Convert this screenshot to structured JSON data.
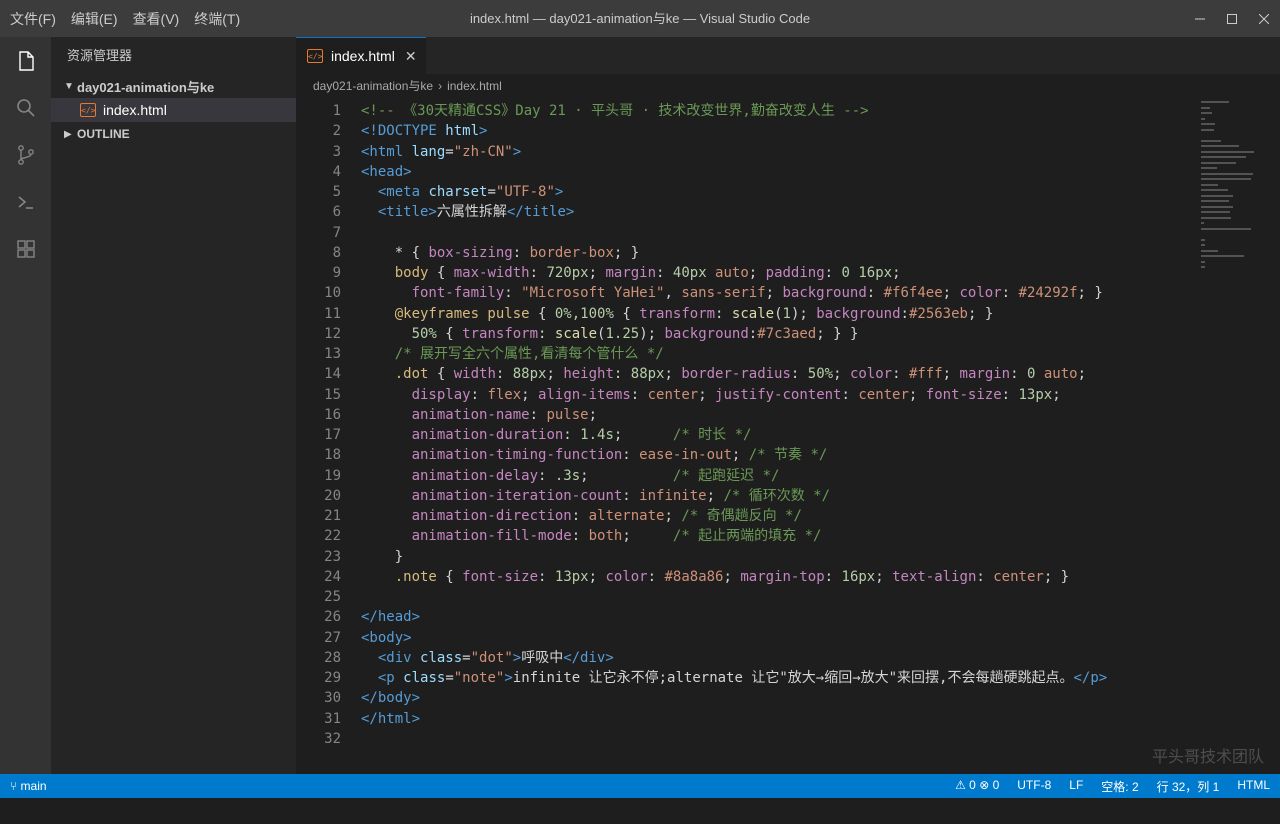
{
  "menu": [
    "文件(F)",
    "编辑(E)",
    "查看(V)",
    "终端(T)"
  ],
  "window_title": "index.html — day021-animation与ke — Visual Studio Code",
  "sidebar": {
    "title": "资源管理器",
    "folder": "day021-animation与ke",
    "file": "index.html",
    "outline": "OUTLINE"
  },
  "tab": {
    "label": "index.html",
    "close": "✕"
  },
  "breadcrumb": {
    "folder": "day021-animation与ke",
    "sep": "›",
    "file": "index.html"
  },
  "code_lines": [
    [
      [
        "com",
        "<!-- 《30天精通CSS》Day 21 · 平头哥 · 技术改变世界,勤奋改变人生 -->"
      ]
    ],
    [
      [
        "tag",
        "<!DOCTYPE "
      ],
      [
        "attr",
        "html"
      ],
      [
        "tag",
        ">"
      ]
    ],
    [
      [
        "tag",
        "<html "
      ],
      [
        "attr",
        "lang"
      ],
      [
        "punc",
        "="
      ],
      [
        "str",
        "\"zh-CN\""
      ],
      [
        "tag",
        ">"
      ]
    ],
    [
      [
        "tag",
        "<head>"
      ]
    ],
    [
      [
        "text",
        "  "
      ],
      [
        "tag",
        "<meta "
      ],
      [
        "attr",
        "charset"
      ],
      [
        "punc",
        "="
      ],
      [
        "str",
        "\"UTF-8\""
      ],
      [
        "tag",
        ">"
      ]
    ],
    [
      [
        "text",
        "  "
      ],
      [
        "tag",
        "<title>"
      ],
      [
        "text",
        "六属性拆解"
      ],
      [
        "tag",
        "</title>"
      ]
    ],
    [
      [
        "text",
        ""
      ]
    ],
    [
      [
        "text",
        "    * "
      ],
      [
        "punc",
        "{ "
      ],
      [
        "prop",
        "box-sizing"
      ],
      [
        "punc",
        ": "
      ],
      [
        "str",
        "border-box"
      ],
      [
        "punc",
        "; }"
      ]
    ],
    [
      [
        "text",
        "    "
      ],
      [
        "sel",
        "body"
      ],
      [
        "punc",
        " { "
      ],
      [
        "prop",
        "max-width"
      ],
      [
        "punc",
        ": "
      ],
      [
        "num",
        "720px"
      ],
      [
        "punc",
        "; "
      ],
      [
        "prop",
        "margin"
      ],
      [
        "punc",
        ": "
      ],
      [
        "num",
        "40px"
      ],
      [
        "str",
        " auto"
      ],
      [
        "punc",
        "; "
      ],
      [
        "prop",
        "padding"
      ],
      [
        "punc",
        ": "
      ],
      [
        "num",
        "0 16px"
      ],
      [
        "punc",
        ";"
      ]
    ],
    [
      [
        "text",
        "      "
      ],
      [
        "prop",
        "font-family"
      ],
      [
        "punc",
        ": "
      ],
      [
        "str",
        "\"Microsoft YaHei\""
      ],
      [
        "punc",
        ", "
      ],
      [
        "str",
        "sans-serif"
      ],
      [
        "punc",
        "; "
      ],
      [
        "prop",
        "background"
      ],
      [
        "punc",
        ": "
      ],
      [
        "str",
        "#f6f4ee"
      ],
      [
        "punc",
        "; "
      ],
      [
        "prop",
        "color"
      ],
      [
        "punc",
        ": "
      ],
      [
        "str",
        "#24292f"
      ],
      [
        "punc",
        "; }"
      ]
    ],
    [
      [
        "text",
        "    "
      ],
      [
        "sel",
        "@keyframes pulse"
      ],
      [
        "punc",
        " { "
      ],
      [
        "num",
        "0%,100%"
      ],
      [
        "punc",
        " { "
      ],
      [
        "prop",
        "transform"
      ],
      [
        "punc",
        ": "
      ],
      [
        "fn",
        "scale"
      ],
      [
        "punc",
        "("
      ],
      [
        "num",
        "1"
      ],
      [
        "punc",
        "); "
      ],
      [
        "prop",
        "background"
      ],
      [
        "punc",
        ":"
      ],
      [
        "str",
        "#2563eb"
      ],
      [
        "punc",
        "; }"
      ]
    ],
    [
      [
        "text",
        "      "
      ],
      [
        "num",
        "50%"
      ],
      [
        "punc",
        " { "
      ],
      [
        "prop",
        "transform"
      ],
      [
        "punc",
        ": "
      ],
      [
        "fn",
        "scale"
      ],
      [
        "punc",
        "("
      ],
      [
        "num",
        "1.25"
      ],
      [
        "punc",
        "); "
      ],
      [
        "prop",
        "background"
      ],
      [
        "punc",
        ":"
      ],
      [
        "str",
        "#7c3aed"
      ],
      [
        "punc",
        "; } }"
      ]
    ],
    [
      [
        "text",
        "    "
      ],
      [
        "com",
        "/* 展开写全六个属性,看清每个管什么 */"
      ]
    ],
    [
      [
        "text",
        "    "
      ],
      [
        "sel",
        ".dot"
      ],
      [
        "punc",
        " { "
      ],
      [
        "prop",
        "width"
      ],
      [
        "punc",
        ": "
      ],
      [
        "num",
        "88px"
      ],
      [
        "punc",
        "; "
      ],
      [
        "prop",
        "height"
      ],
      [
        "punc",
        ": "
      ],
      [
        "num",
        "88px"
      ],
      [
        "punc",
        "; "
      ],
      [
        "prop",
        "border-radius"
      ],
      [
        "punc",
        ": "
      ],
      [
        "num",
        "50%"
      ],
      [
        "punc",
        "; "
      ],
      [
        "prop",
        "color"
      ],
      [
        "punc",
        ": "
      ],
      [
        "str",
        "#fff"
      ],
      [
        "punc",
        "; "
      ],
      [
        "prop",
        "margin"
      ],
      [
        "punc",
        ": "
      ],
      [
        "num",
        "0"
      ],
      [
        "str",
        " auto"
      ],
      [
        "punc",
        ";"
      ]
    ],
    [
      [
        "text",
        "      "
      ],
      [
        "prop",
        "display"
      ],
      [
        "punc",
        ": "
      ],
      [
        "str",
        "flex"
      ],
      [
        "punc",
        "; "
      ],
      [
        "prop",
        "align-items"
      ],
      [
        "punc",
        ": "
      ],
      [
        "str",
        "center"
      ],
      [
        "punc",
        "; "
      ],
      [
        "prop",
        "justify-content"
      ],
      [
        "punc",
        ": "
      ],
      [
        "str",
        "center"
      ],
      [
        "punc",
        "; "
      ],
      [
        "prop",
        "font-size"
      ],
      [
        "punc",
        ": "
      ],
      [
        "num",
        "13px"
      ],
      [
        "punc",
        ";"
      ]
    ],
    [
      [
        "text",
        "      "
      ],
      [
        "prop",
        "animation-name"
      ],
      [
        "punc",
        ": "
      ],
      [
        "str",
        "pulse"
      ],
      [
        "punc",
        ";"
      ]
    ],
    [
      [
        "text",
        "      "
      ],
      [
        "prop",
        "animation-duration"
      ],
      [
        "punc",
        ": "
      ],
      [
        "num",
        "1.4s"
      ],
      [
        "punc",
        ";      "
      ],
      [
        "com",
        "/* 时长 */"
      ]
    ],
    [
      [
        "text",
        "      "
      ],
      [
        "prop",
        "animation-timing-function"
      ],
      [
        "punc",
        ": "
      ],
      [
        "str",
        "ease-in-out"
      ],
      [
        "punc",
        "; "
      ],
      [
        "com",
        "/* 节奏 */"
      ]
    ],
    [
      [
        "text",
        "      "
      ],
      [
        "prop",
        "animation-delay"
      ],
      [
        "punc",
        ": "
      ],
      [
        "num",
        ".3s"
      ],
      [
        "punc",
        ";          "
      ],
      [
        "com",
        "/* 起跑延迟 */"
      ]
    ],
    [
      [
        "text",
        "      "
      ],
      [
        "prop",
        "animation-iteration-count"
      ],
      [
        "punc",
        ": "
      ],
      [
        "str",
        "infinite"
      ],
      [
        "punc",
        "; "
      ],
      [
        "com",
        "/* 循环次数 */"
      ]
    ],
    [
      [
        "text",
        "      "
      ],
      [
        "prop",
        "animation-direction"
      ],
      [
        "punc",
        ": "
      ],
      [
        "str",
        "alternate"
      ],
      [
        "punc",
        "; "
      ],
      [
        "com",
        "/* 奇偶趟反向 */"
      ]
    ],
    [
      [
        "text",
        "      "
      ],
      [
        "prop",
        "animation-fill-mode"
      ],
      [
        "punc",
        ": "
      ],
      [
        "str",
        "both"
      ],
      [
        "punc",
        ";     "
      ],
      [
        "com",
        "/* 起止两端的填充 */"
      ]
    ],
    [
      [
        "punc",
        "    }"
      ]
    ],
    [
      [
        "text",
        "    "
      ],
      [
        "sel",
        ".note"
      ],
      [
        "punc",
        " { "
      ],
      [
        "prop",
        "font-size"
      ],
      [
        "punc",
        ": "
      ],
      [
        "num",
        "13px"
      ],
      [
        "punc",
        "; "
      ],
      [
        "prop",
        "color"
      ],
      [
        "punc",
        ": "
      ],
      [
        "str",
        "#8a8a86"
      ],
      [
        "punc",
        "; "
      ],
      [
        "prop",
        "margin-top"
      ],
      [
        "punc",
        ": "
      ],
      [
        "num",
        "16px"
      ],
      [
        "punc",
        "; "
      ],
      [
        "prop",
        "text-align"
      ],
      [
        "punc",
        ": "
      ],
      [
        "str",
        "center"
      ],
      [
        "punc",
        "; }"
      ]
    ],
    [
      [
        "text",
        ""
      ]
    ],
    [
      [
        "tag",
        "</head>"
      ]
    ],
    [
      [
        "tag",
        "<body>"
      ]
    ],
    [
      [
        "text",
        "  "
      ],
      [
        "tag",
        "<div "
      ],
      [
        "attr",
        "class"
      ],
      [
        "punc",
        "="
      ],
      [
        "str",
        "\"dot\""
      ],
      [
        "tag",
        ">"
      ],
      [
        "text",
        "呼吸中"
      ],
      [
        "tag",
        "</div>"
      ]
    ],
    [
      [
        "text",
        "  "
      ],
      [
        "tag",
        "<p "
      ],
      [
        "attr",
        "class"
      ],
      [
        "punc",
        "="
      ],
      [
        "str",
        "\"note\""
      ],
      [
        "tag",
        ">"
      ],
      [
        "text",
        "infinite 让它永不停;alternate 让它\"放大→缩回→放大\"来回摆,不会每趟硬跳起点。"
      ],
      [
        "tag",
        "</p>"
      ]
    ],
    [
      [
        "tag",
        "</body>"
      ]
    ],
    [
      [
        "tag",
        "</html>"
      ]
    ],
    [
      [
        "text",
        ""
      ]
    ]
  ],
  "watermark": "平头哥技术团队",
  "status": {
    "branch": "main",
    "problems": "⚠ 0  ⊗ 0",
    "encoding": "UTF-8",
    "eol": "LF",
    "indent": "空格: 2",
    "position": "行 32，列 1",
    "language": "HTML"
  },
  "colors": {
    "accent": "#007acc",
    "editor_bg": "#1e1e1e",
    "sidebar_bg": "#252526"
  }
}
